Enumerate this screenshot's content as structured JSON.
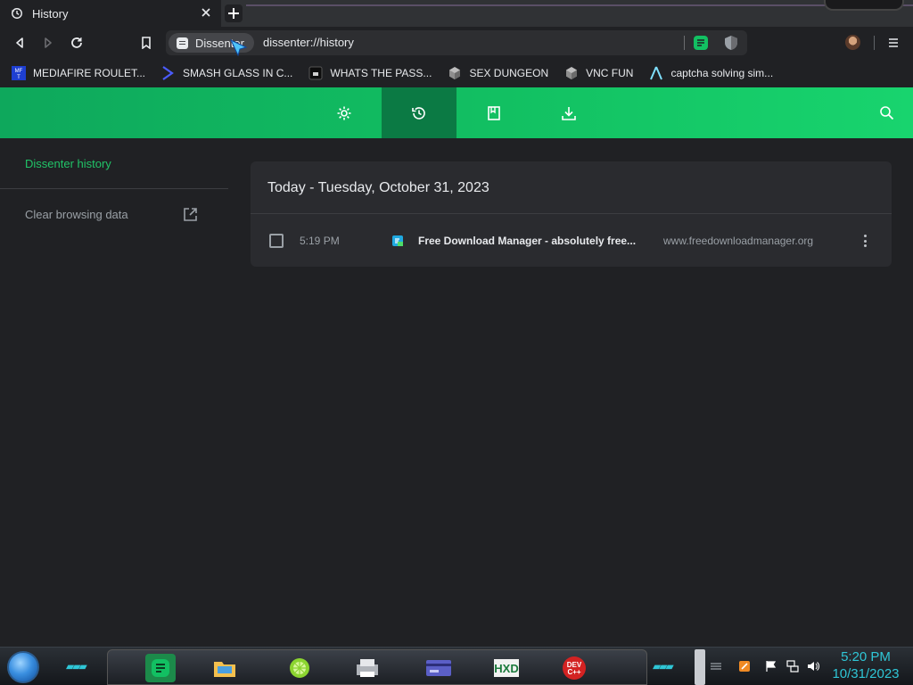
{
  "tab": {
    "title": "History"
  },
  "address": {
    "site_chip": "Dissenter",
    "url": "dissenter://history"
  },
  "bookmarks": [
    {
      "label": "MEDIAFIRE ROULET...",
      "icon": "mediafire-icon"
    },
    {
      "label": "SMASH GLASS IN C...",
      "icon": "chevron-logo-icon"
    },
    {
      "label": "WHATS THE PASS...",
      "icon": "dark-square-icon"
    },
    {
      "label": "SEX DUNGEON",
      "icon": "cube-icon"
    },
    {
      "label": "VNC FUN",
      "icon": "cube-icon"
    },
    {
      "label": "captcha solving sim...",
      "icon": "triangle-logo-icon"
    }
  ],
  "sidebar": {
    "title": "Dissenter history",
    "clear": "Clear browsing data"
  },
  "history": {
    "heading": "Today - Tuesday, October 31, 2023",
    "entries": [
      {
        "time": "5:19 PM",
        "title": "Free Download Manager - absolutely free...",
        "domain": "www.freedownloadmanager.org"
      }
    ]
  },
  "taskbar": {
    "time": "5:20 PM",
    "date": "10/31/2023"
  },
  "colors": {
    "accent": "#12c062",
    "active_nav": "#0b7a44",
    "clock": "#2fc6d6"
  }
}
